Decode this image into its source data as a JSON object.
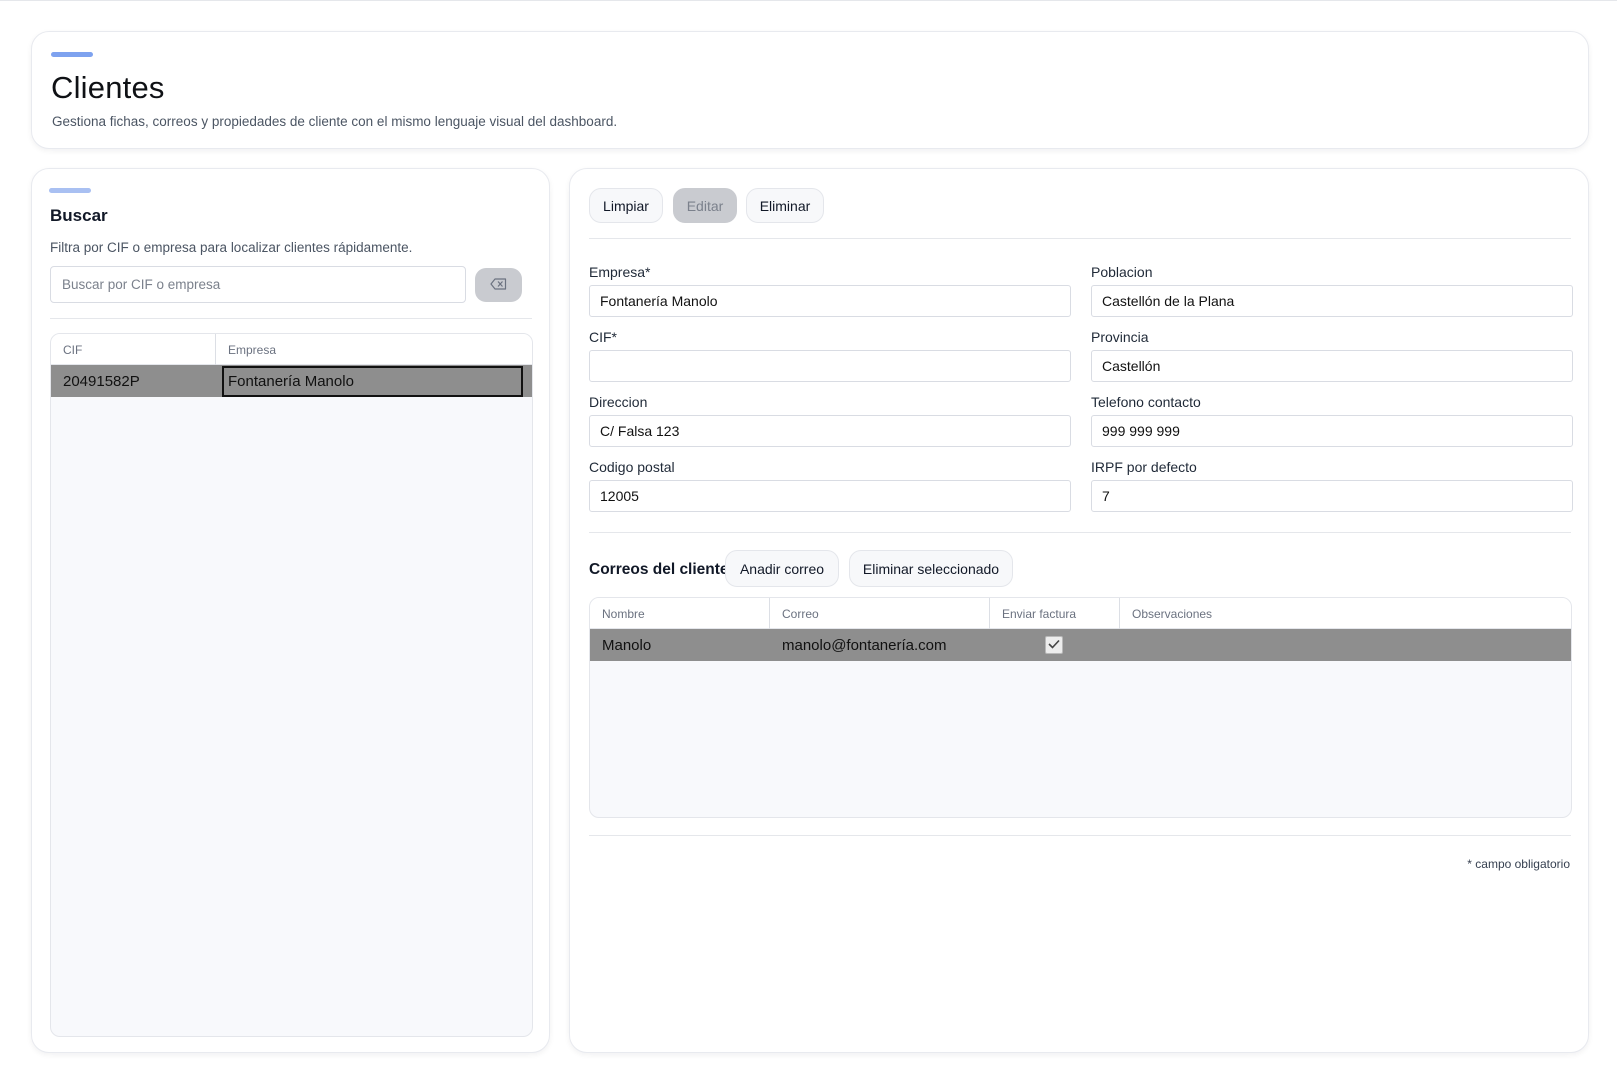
{
  "header": {
    "title": "Clientes",
    "subtitle": "Gestiona fichas, correos y propiedades de cliente con el mismo lenguaje visual del dashboard."
  },
  "search": {
    "title": "Buscar",
    "description": "Filtra por CIF o empresa para localizar clientes rápidamente.",
    "placeholder": "Buscar por CIF o empresa",
    "value": "",
    "clear_icon": "backspace-icon"
  },
  "clients_table": {
    "columns": [
      "CIF",
      "Empresa"
    ],
    "rows": [
      {
        "cif": "20491582P",
        "empresa": "Fontanería Manolo",
        "selected": true
      }
    ]
  },
  "toolbar": {
    "clear_label": "Limpiar",
    "edit_label": "Editar",
    "delete_label": "Eliminar"
  },
  "form": {
    "empresa": {
      "label": "Empresa*",
      "value": "Fontanería Manolo"
    },
    "cif": {
      "label": "CIF*",
      "value": ""
    },
    "direccion": {
      "label": "Direccion",
      "value": "C/ Falsa 123"
    },
    "codigo_postal": {
      "label": "Codigo postal",
      "value": "12005"
    },
    "poblacion": {
      "label": "Poblacion",
      "value": "Castellón de la Plana"
    },
    "provincia": {
      "label": "Provincia",
      "value": "Castellón"
    },
    "telefono": {
      "label": "Telefono contacto",
      "value": "999 999 999"
    },
    "irpf": {
      "label": "IRPF por defecto",
      "value": "7"
    }
  },
  "mails": {
    "title": "Correos del cliente",
    "add_label": "Anadir correo",
    "delete_selected_label": "Eliminar seleccionado",
    "columns": [
      "Nombre",
      "Correo",
      "Enviar factura",
      "Observaciones"
    ],
    "rows": [
      {
        "nombre": "Manolo",
        "correo": "manolo@fontanería.com",
        "enviar_factura": true,
        "observaciones": ""
      }
    ]
  },
  "required_note": "* campo obligatorio",
  "colors": {
    "accent": "#7ea2ef",
    "selected_row": "#8e8e8e",
    "disabled_button": "#c9cbd0"
  }
}
